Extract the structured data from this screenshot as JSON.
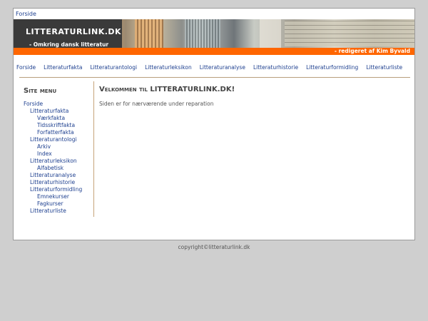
{
  "topbar": {
    "home_label": "Forside"
  },
  "header": {
    "title": "LITTERATURLINK.DK",
    "subtitle": "- Omkring dansk litteratur",
    "editor": "- redigeret af Kim Byvald",
    "accent_color": "#ff6600"
  },
  "nav": {
    "items": [
      {
        "label": "Forside"
      },
      {
        "label": "Litteraturfakta"
      },
      {
        "label": "Litteraturantologi"
      },
      {
        "label": "Litteraturleksikon"
      },
      {
        "label": "Litteraturanalyse"
      },
      {
        "label": "Litteraturhistorie"
      },
      {
        "label": "Litteraturformidling"
      },
      {
        "label": "Litteraturliste"
      }
    ]
  },
  "sidebar": {
    "title": "Site menu",
    "items": [
      {
        "label": "Forside",
        "level": 0
      },
      {
        "label": "Litteraturfakta",
        "level": 1
      },
      {
        "label": "Værkfakta",
        "level": 2
      },
      {
        "label": "Tidsskriftfakta",
        "level": 2
      },
      {
        "label": "Forfatterfakta",
        "level": 2
      },
      {
        "label": "Litteraturantologi",
        "level": 1
      },
      {
        "label": "Arkiv",
        "level": 2
      },
      {
        "label": "Index",
        "level": 2
      },
      {
        "label": "Litteraturleksikon",
        "level": 1
      },
      {
        "label": "Alfabetisk",
        "level": 2
      },
      {
        "label": "Litteraturanalyse",
        "level": 1
      },
      {
        "label": "Litteraturhistorie",
        "level": 1
      },
      {
        "label": "Litteraturformidling",
        "level": 1
      },
      {
        "label": "Emnekurser",
        "level": 2
      },
      {
        "label": "Fagkurser",
        "level": 2
      },
      {
        "label": "Litteraturliste",
        "level": 1
      }
    ]
  },
  "main": {
    "welcome": "Velkommen til LITTERATURLINK.DK!",
    "status": "Siden er for nærværende under reparation"
  },
  "footer": {
    "copyright": "copyright©litteraturlink.dk"
  }
}
